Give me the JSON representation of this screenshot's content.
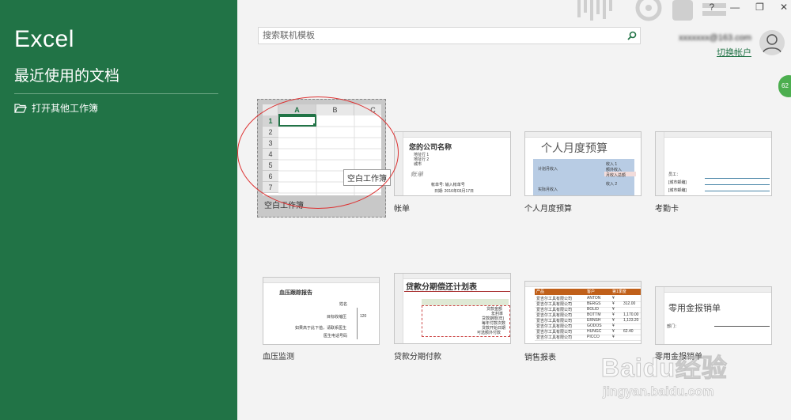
{
  "app": {
    "name": "Excel"
  },
  "sidebar": {
    "section_title": "最近使用的文档",
    "open_other_label": "打开其他工作簿"
  },
  "search": {
    "placeholder": "搜索联机模板"
  },
  "window_controls": {
    "help": "?",
    "minimize": "—",
    "restore": "❐",
    "close": "✕"
  },
  "account": {
    "name": "xxxxxxx@163.com",
    "switch_label": "切换帐户"
  },
  "badge": {
    "value": "62"
  },
  "blank_grid": {
    "columns": [
      "A",
      "B",
      "C"
    ],
    "rows": [
      "1",
      "2",
      "3",
      "4",
      "5",
      "6",
      "7"
    ]
  },
  "templates": [
    {
      "id": "blank",
      "label": "空白工作簿",
      "tooltip": "空白工作簿"
    },
    {
      "id": "invoice",
      "label": "帐单",
      "thumb": {
        "company": "您的公司名称",
        "address1": "地址行 1",
        "address2": "地址行 2",
        "city": "城市",
        "bill_to": "帐单",
        "account_no": "帐单号:",
        "account_no_value": "输入帐单号",
        "date_label": "日期:",
        "date_value": "2016年03月17日"
      }
    },
    {
      "id": "budget",
      "label": "个人月度预算",
      "thumb": {
        "title": "个人月度预算",
        "planned_income": "计划月收入",
        "actual_income": "实际月收入",
        "income1": "收入 1",
        "extra_income": "额外收入",
        "total_income": "月收入总额",
        "income2": "收入 2"
      }
    },
    {
      "id": "attendance",
      "label": "考勤卡",
      "thumb": {
        "employee": "员工：",
        "manager": "[城市邮编]",
        "note": "[城市邮编]"
      }
    },
    {
      "id": "blood_pressure",
      "label": "血压监测",
      "thumb": {
        "title": "血压跟踪报告",
        "name_label": "姓名",
        "target_systolic": "目标收缩压",
        "target_value": "120",
        "note1": "如果高于此下值，请联系医生",
        "note2": "医生电话号码"
      }
    },
    {
      "id": "loan",
      "label": "贷款分期付款",
      "thumb": {
        "title": "贷款分期偿还计划表",
        "l1": "贷款金额",
        "l2": "年利率",
        "l3": "贷款期限(年)",
        "l4": "每年付款次数",
        "l5": "贷款开始日期",
        "l6": "可选额外付款"
      }
    },
    {
      "id": "sales",
      "label": "销售报表",
      "thumb": {
        "headers": [
          "产品",
          "客户",
          "第1季度"
        ],
        "rows": [
          [
            "爱吉尔工具有限公司",
            "ANTON",
            "¥",
            ""
          ],
          [
            "爱吉尔工具有限公司",
            "BERGS",
            "¥",
            "312.00"
          ],
          [
            "爱吉尔工具有限公司",
            "BOLID",
            "¥",
            ""
          ],
          [
            "爱吉尔工具有限公司",
            "BOTTM",
            "¥",
            "1,170.00"
          ],
          [
            "爱吉尔工具有限公司",
            "ERNSH",
            "¥",
            "1,123.20"
          ],
          [
            "爱吉尔工具有限公司",
            "GODOS",
            "¥",
            ""
          ],
          [
            "爱吉尔工具有限公司",
            "HUNGC",
            "¥",
            "62.40"
          ],
          [
            "爱吉尔工具有限公司",
            "PICCO",
            "¥",
            ""
          ]
        ]
      }
    },
    {
      "id": "petty_cash",
      "label": "零用金报销单",
      "thumb": {
        "title": "零用金报销单",
        "field": "部门："
      }
    }
  ],
  "watermark": {
    "text": "Baidu经验",
    "url": "jingyan.baidu.com"
  },
  "colors": {
    "sidebar": "#217346",
    "accent": "#217346",
    "annotation": "#dd3333"
  }
}
